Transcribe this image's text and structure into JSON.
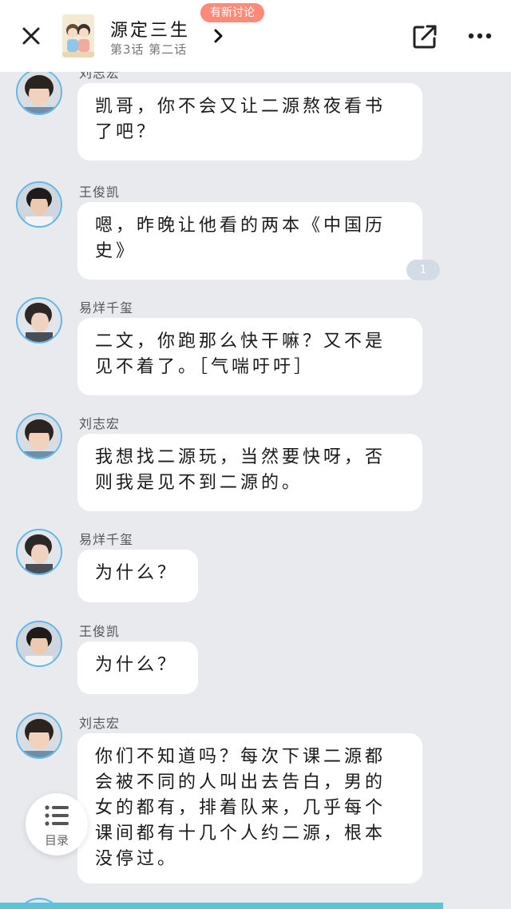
{
  "header": {
    "title": "源定三生",
    "subtitle": "第3话 第二话",
    "badge": "有新讨论",
    "close_icon": "close-icon",
    "chevron_icon": "chevron-right-icon",
    "share_icon": "share-icon",
    "more_icon": "more-dots-icon"
  },
  "messages": [
    {
      "sender": "刘志宏",
      "text": "凯哥，你不会又让二源熬夜看书了吧？"
    },
    {
      "sender": "王俊凯",
      "text": "嗯，昨晚让他看的两本《中国历史》",
      "comment_count": "1"
    },
    {
      "sender": "易烊千玺",
      "text": "二文，你跑那么快干嘛？又不是见不着了。［气喘吁吁］"
    },
    {
      "sender": "刘志宏",
      "text": "我想找二源玩，当然要快呀，否则我是见不到二源的。"
    },
    {
      "sender": "易烊千玺",
      "text": "为什么？"
    },
    {
      "sender": "王俊凯",
      "text": "为什么？"
    },
    {
      "sender": "刘志宏",
      "text": "你们不知道吗？每次下课二源都会被不同的人叫出去告白，男的女的都有，排着队来，几乎每个课间都有十几个人约二源，根本没停过。"
    }
  ],
  "toc": {
    "label": "目录",
    "icon": "list-icon"
  },
  "colors": {
    "background": "#e9eaee",
    "badge": "#ff8a78",
    "avatar_ring": "#5fb8ea",
    "progress": "#57c6d8"
  }
}
